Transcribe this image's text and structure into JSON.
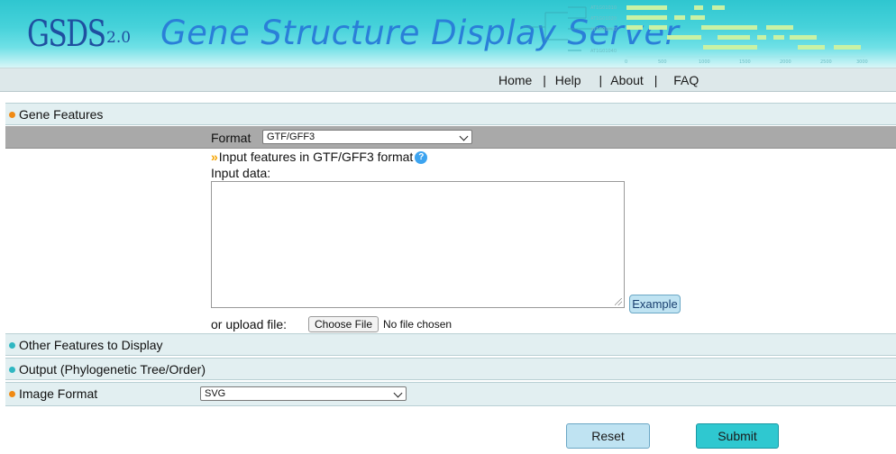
{
  "banner": {
    "logo": "GSDS",
    "logo_version": "2.0",
    "tagline": "Gene Structure Display Server"
  },
  "nav": {
    "items": [
      "Home",
      "Help",
      "About",
      "FAQ"
    ],
    "separator": "|"
  },
  "sections": {
    "gene_features": "Gene Features",
    "other_features": "Other Features to Display",
    "output": "Output (Phylogenetic Tree/Order)",
    "image_format": "Image Format"
  },
  "format": {
    "label": "Format",
    "selected": "GTF/GFF3"
  },
  "input": {
    "hint": "Input features in GTF/GFF3 format",
    "help_icon": "question-icon",
    "data_label": "Input data:",
    "value": "",
    "example_label": "Example"
  },
  "upload": {
    "label": "or upload file:",
    "button": "Choose File",
    "status": "No file chosen"
  },
  "image_format": {
    "selected": "SVG"
  },
  "buttons": {
    "reset": "Reset",
    "submit": "Submit"
  },
  "colors": {
    "accent_orange": "#f08a14",
    "accent_teal": "#2fb7c2",
    "banner": "#2fc6d0",
    "submit": "#2fc8d0"
  }
}
